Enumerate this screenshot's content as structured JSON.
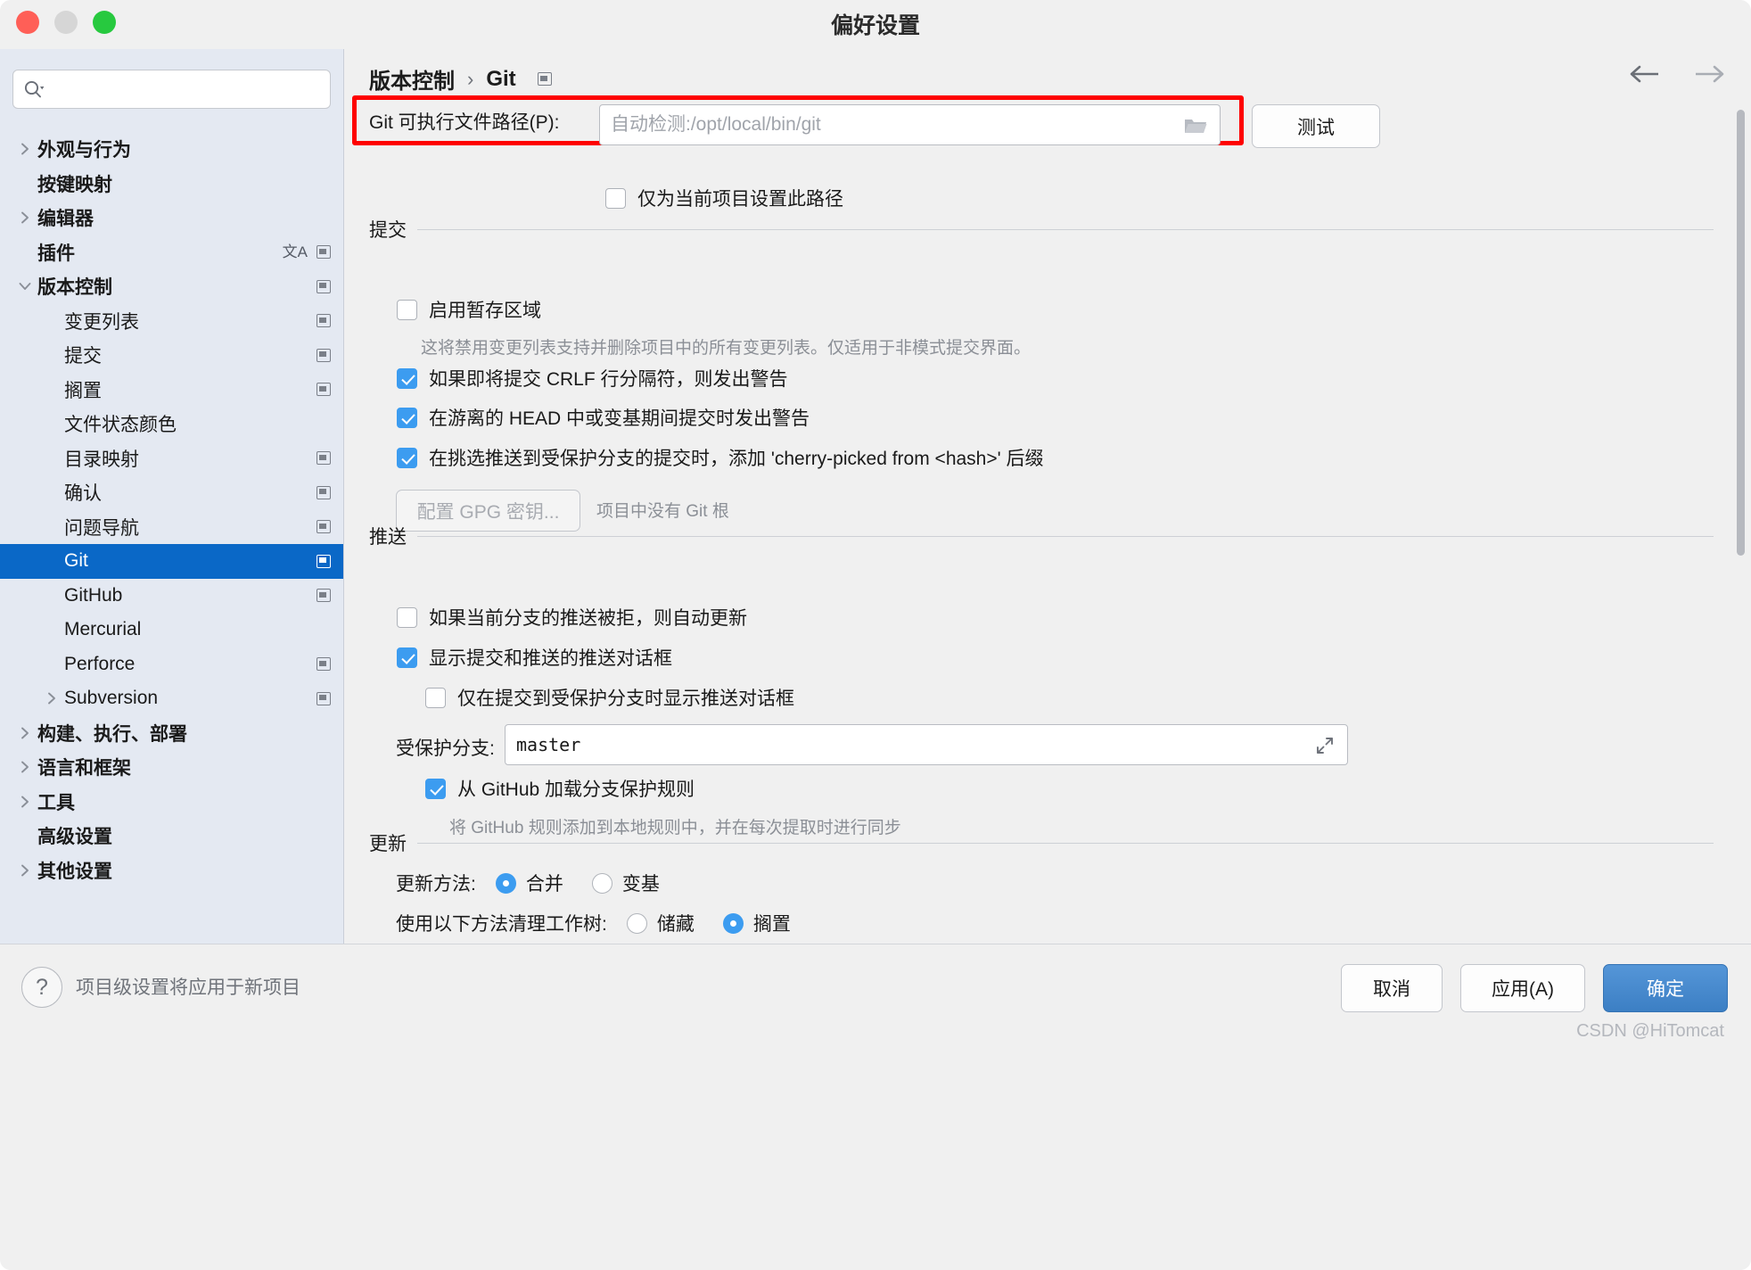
{
  "window": {
    "title": "偏好设置",
    "traffic_lights": [
      "close-button",
      "minimize-button",
      "zoom-button"
    ]
  },
  "sidebar": {
    "search": {
      "value": "",
      "placeholder": ""
    },
    "items": [
      {
        "label": "外观与行为",
        "level": 0,
        "arrow": "right",
        "bold": true,
        "selected": false,
        "badges": []
      },
      {
        "label": "按键映射",
        "level": 0,
        "arrow": "none",
        "bold": true,
        "selected": false,
        "badges": []
      },
      {
        "label": "编辑器",
        "level": 0,
        "arrow": "right",
        "bold": true,
        "selected": false,
        "badges": []
      },
      {
        "label": "插件",
        "level": 0,
        "arrow": "none",
        "bold": true,
        "selected": false,
        "badges": [
          "lang",
          "copy"
        ]
      },
      {
        "label": "版本控制",
        "level": 0,
        "arrow": "down",
        "bold": true,
        "selected": false,
        "badges": [
          "copy"
        ]
      },
      {
        "label": "变更列表",
        "level": 1,
        "arrow": "none",
        "bold": false,
        "selected": false,
        "badges": [
          "copy"
        ]
      },
      {
        "label": "提交",
        "level": 1,
        "arrow": "none",
        "bold": false,
        "selected": false,
        "badges": [
          "copy"
        ]
      },
      {
        "label": "搁置",
        "level": 1,
        "arrow": "none",
        "bold": false,
        "selected": false,
        "badges": [
          "copy"
        ]
      },
      {
        "label": "文件状态颜色",
        "level": 1,
        "arrow": "none",
        "bold": false,
        "selected": false,
        "badges": []
      },
      {
        "label": "目录映射",
        "level": 1,
        "arrow": "none",
        "bold": false,
        "selected": false,
        "badges": [
          "copy"
        ]
      },
      {
        "label": "确认",
        "level": 1,
        "arrow": "none",
        "bold": false,
        "selected": false,
        "badges": [
          "copy"
        ]
      },
      {
        "label": "问题导航",
        "level": 1,
        "arrow": "none",
        "bold": false,
        "selected": false,
        "badges": [
          "copy"
        ]
      },
      {
        "label": "Git",
        "level": 1,
        "arrow": "none",
        "bold": false,
        "selected": true,
        "badges": [
          "copy"
        ]
      },
      {
        "label": "GitHub",
        "level": 1,
        "arrow": "none",
        "bold": false,
        "selected": false,
        "badges": [
          "copy"
        ]
      },
      {
        "label": "Mercurial",
        "level": 1,
        "arrow": "none",
        "bold": false,
        "selected": false,
        "badges": []
      },
      {
        "label": "Perforce",
        "level": 1,
        "arrow": "none",
        "bold": false,
        "selected": false,
        "badges": [
          "copy"
        ]
      },
      {
        "label": "Subversion",
        "level": 1,
        "arrow": "right",
        "bold": false,
        "selected": false,
        "badges": [
          "copy"
        ]
      },
      {
        "label": "构建、执行、部署",
        "level": 0,
        "arrow": "right",
        "bold": true,
        "selected": false,
        "badges": []
      },
      {
        "label": "语言和框架",
        "level": 0,
        "arrow": "right",
        "bold": true,
        "selected": false,
        "badges": []
      },
      {
        "label": "工具",
        "level": 0,
        "arrow": "right",
        "bold": true,
        "selected": false,
        "badges": []
      },
      {
        "label": "高级设置",
        "level": 0,
        "arrow": "none",
        "bold": true,
        "selected": false,
        "badges": []
      },
      {
        "label": "其他设置",
        "level": 0,
        "arrow": "right",
        "bold": true,
        "selected": false,
        "badges": []
      }
    ]
  },
  "content": {
    "breadcrumb": {
      "parent": "版本控制",
      "separator": "›",
      "current": "Git"
    },
    "git_path": {
      "label": "Git 可执行文件路径(P):",
      "value": "",
      "placeholder": "自动检测:/opt/local/bin/git",
      "test_button": "测试",
      "project_only_checkbox": {
        "label": "仅为当前项目设置此路径",
        "checked": false
      }
    },
    "commit": {
      "title": "提交",
      "staging_area": {
        "label": "启用暂存区域",
        "checked": false
      },
      "staging_hint": "这将禁用变更列表支持并删除项目中的所有变更列表。仅适用于非模式提交界面。",
      "crlf_warning": {
        "label": "如果即将提交 CRLF 行分隔符，则发出警告",
        "checked": true
      },
      "detached_head_warning": {
        "label": "在游离的 HEAD 中或变基期间提交时发出警告",
        "checked": true
      },
      "cherry_pick_suffix": {
        "label": "在挑选推送到受保护分支的提交时，添加 'cherry-picked from <hash>' 后缀",
        "checked": true
      },
      "gpg_button": "配置 GPG 密钥...",
      "gpg_note": "项目中没有 Git 根"
    },
    "push": {
      "title": "推送",
      "auto_update": {
        "label": "如果当前分支的推送被拒，则自动更新",
        "checked": false
      },
      "show_push_dialog": {
        "label": "显示提交和推送的推送对话框",
        "checked": true
      },
      "only_protected": {
        "label": "仅在提交到受保护分支时显示推送对话框",
        "checked": false
      },
      "protected_branches_label": "受保护分支:",
      "protected_branches_value": "master",
      "load_github_rules": {
        "label": "从 GitHub 加载分支保护规则",
        "checked": true
      },
      "load_github_hint": "将 GitHub 规则添加到本地规则中，并在每次提取时进行同步"
    },
    "update": {
      "title": "更新",
      "method_label": "更新方法:",
      "method_options": [
        {
          "label": "合并",
          "selected": true
        },
        {
          "label": "变基",
          "selected": false
        }
      ],
      "clean_label": "使用以下方法清理工作树:",
      "clean_options": [
        {
          "label": "储藏",
          "selected": false
        },
        {
          "label": "搁置",
          "selected": true
        }
      ]
    }
  },
  "footer": {
    "help_glyph": "?",
    "note": "项目级设置将应用于新项目",
    "buttons": [
      {
        "label": "取消",
        "style": "default"
      },
      {
        "label": "应用(A)",
        "style": "default"
      },
      {
        "label": "确定",
        "style": "primary"
      }
    ],
    "watermark": "CSDN @HiTomcat"
  },
  "colors": {
    "selection": "#0a68c7",
    "accent": "#3c9cf0",
    "highlight_box": "#fe0000",
    "primary_button": "#3c7fc4"
  }
}
